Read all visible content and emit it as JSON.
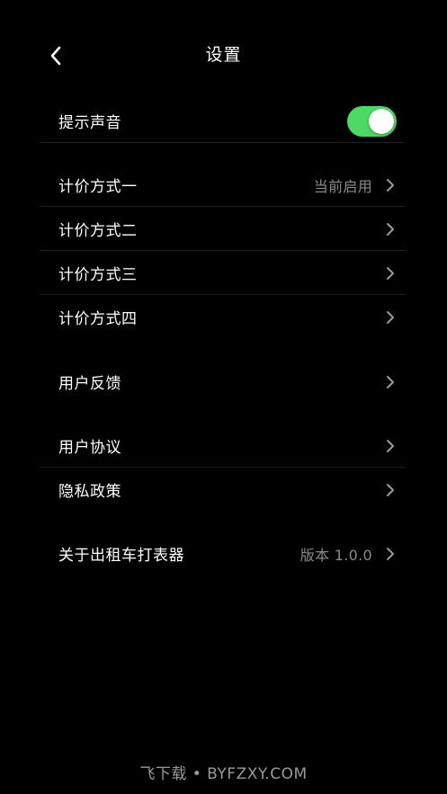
{
  "header": {
    "title": "设置",
    "back_icon": "chevron-left-icon"
  },
  "sound": {
    "label": "提示声音",
    "toggle_on": true,
    "toggle_color": "#4cd964"
  },
  "pricing": {
    "items": [
      {
        "label": "计价方式一",
        "value": "当前启用"
      },
      {
        "label": "计价方式二"
      },
      {
        "label": "计价方式三"
      },
      {
        "label": "计价方式四"
      }
    ]
  },
  "feedback": {
    "label": "用户反馈"
  },
  "legal": {
    "items": [
      {
        "label": "用户协议"
      },
      {
        "label": "隐私政策"
      }
    ]
  },
  "about": {
    "label": "关于出租车打表器",
    "value": "版本 1.0.0"
  },
  "watermark": "飞下载 • BYFZXY.COM"
}
